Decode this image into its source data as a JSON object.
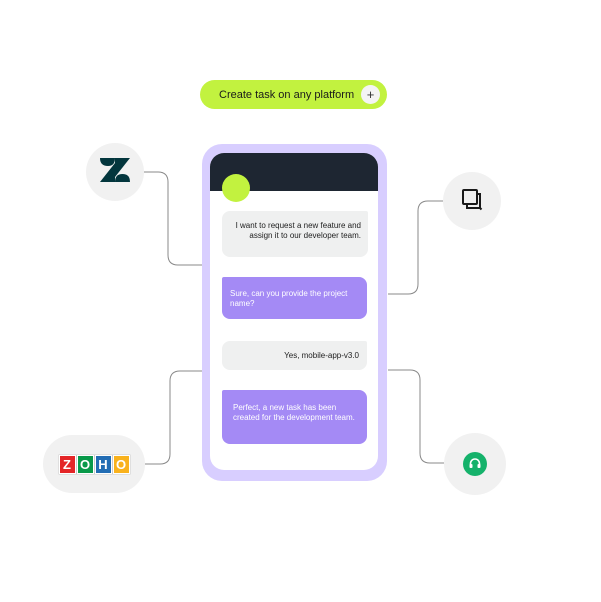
{
  "header": {
    "create_task_label": "Create task on any platform",
    "plus_symbol": "+"
  },
  "chat": {
    "messages": [
      {
        "sender": "user",
        "text": "I want to request a new feature and assign it to our developer team."
      },
      {
        "sender": "bot",
        "text": "Sure, can you provide the project name?"
      },
      {
        "sender": "user",
        "text": "Yes, mobile-app-v3.0"
      },
      {
        "sender": "bot",
        "text": "Perfect, a new task has been created for the development team."
      }
    ]
  },
  "platforms": {
    "zoho": {
      "letters": [
        "Z",
        "O",
        "H",
        "O"
      ],
      "colors": [
        "#e42527",
        "#089949",
        "#226db4",
        "#f9b21d"
      ]
    },
    "icons": [
      "zendesk-icon",
      "square-chat-icon",
      "zoho-icon",
      "headset-support-icon"
    ]
  },
  "colors": {
    "accent_green": "#c2f23f",
    "phone_frame": "#d8ceff",
    "bot_bubble": "#a48af5",
    "user_bubble": "#eff0f0",
    "header_dark": "#1e2632",
    "support_green": "#15b26b"
  }
}
